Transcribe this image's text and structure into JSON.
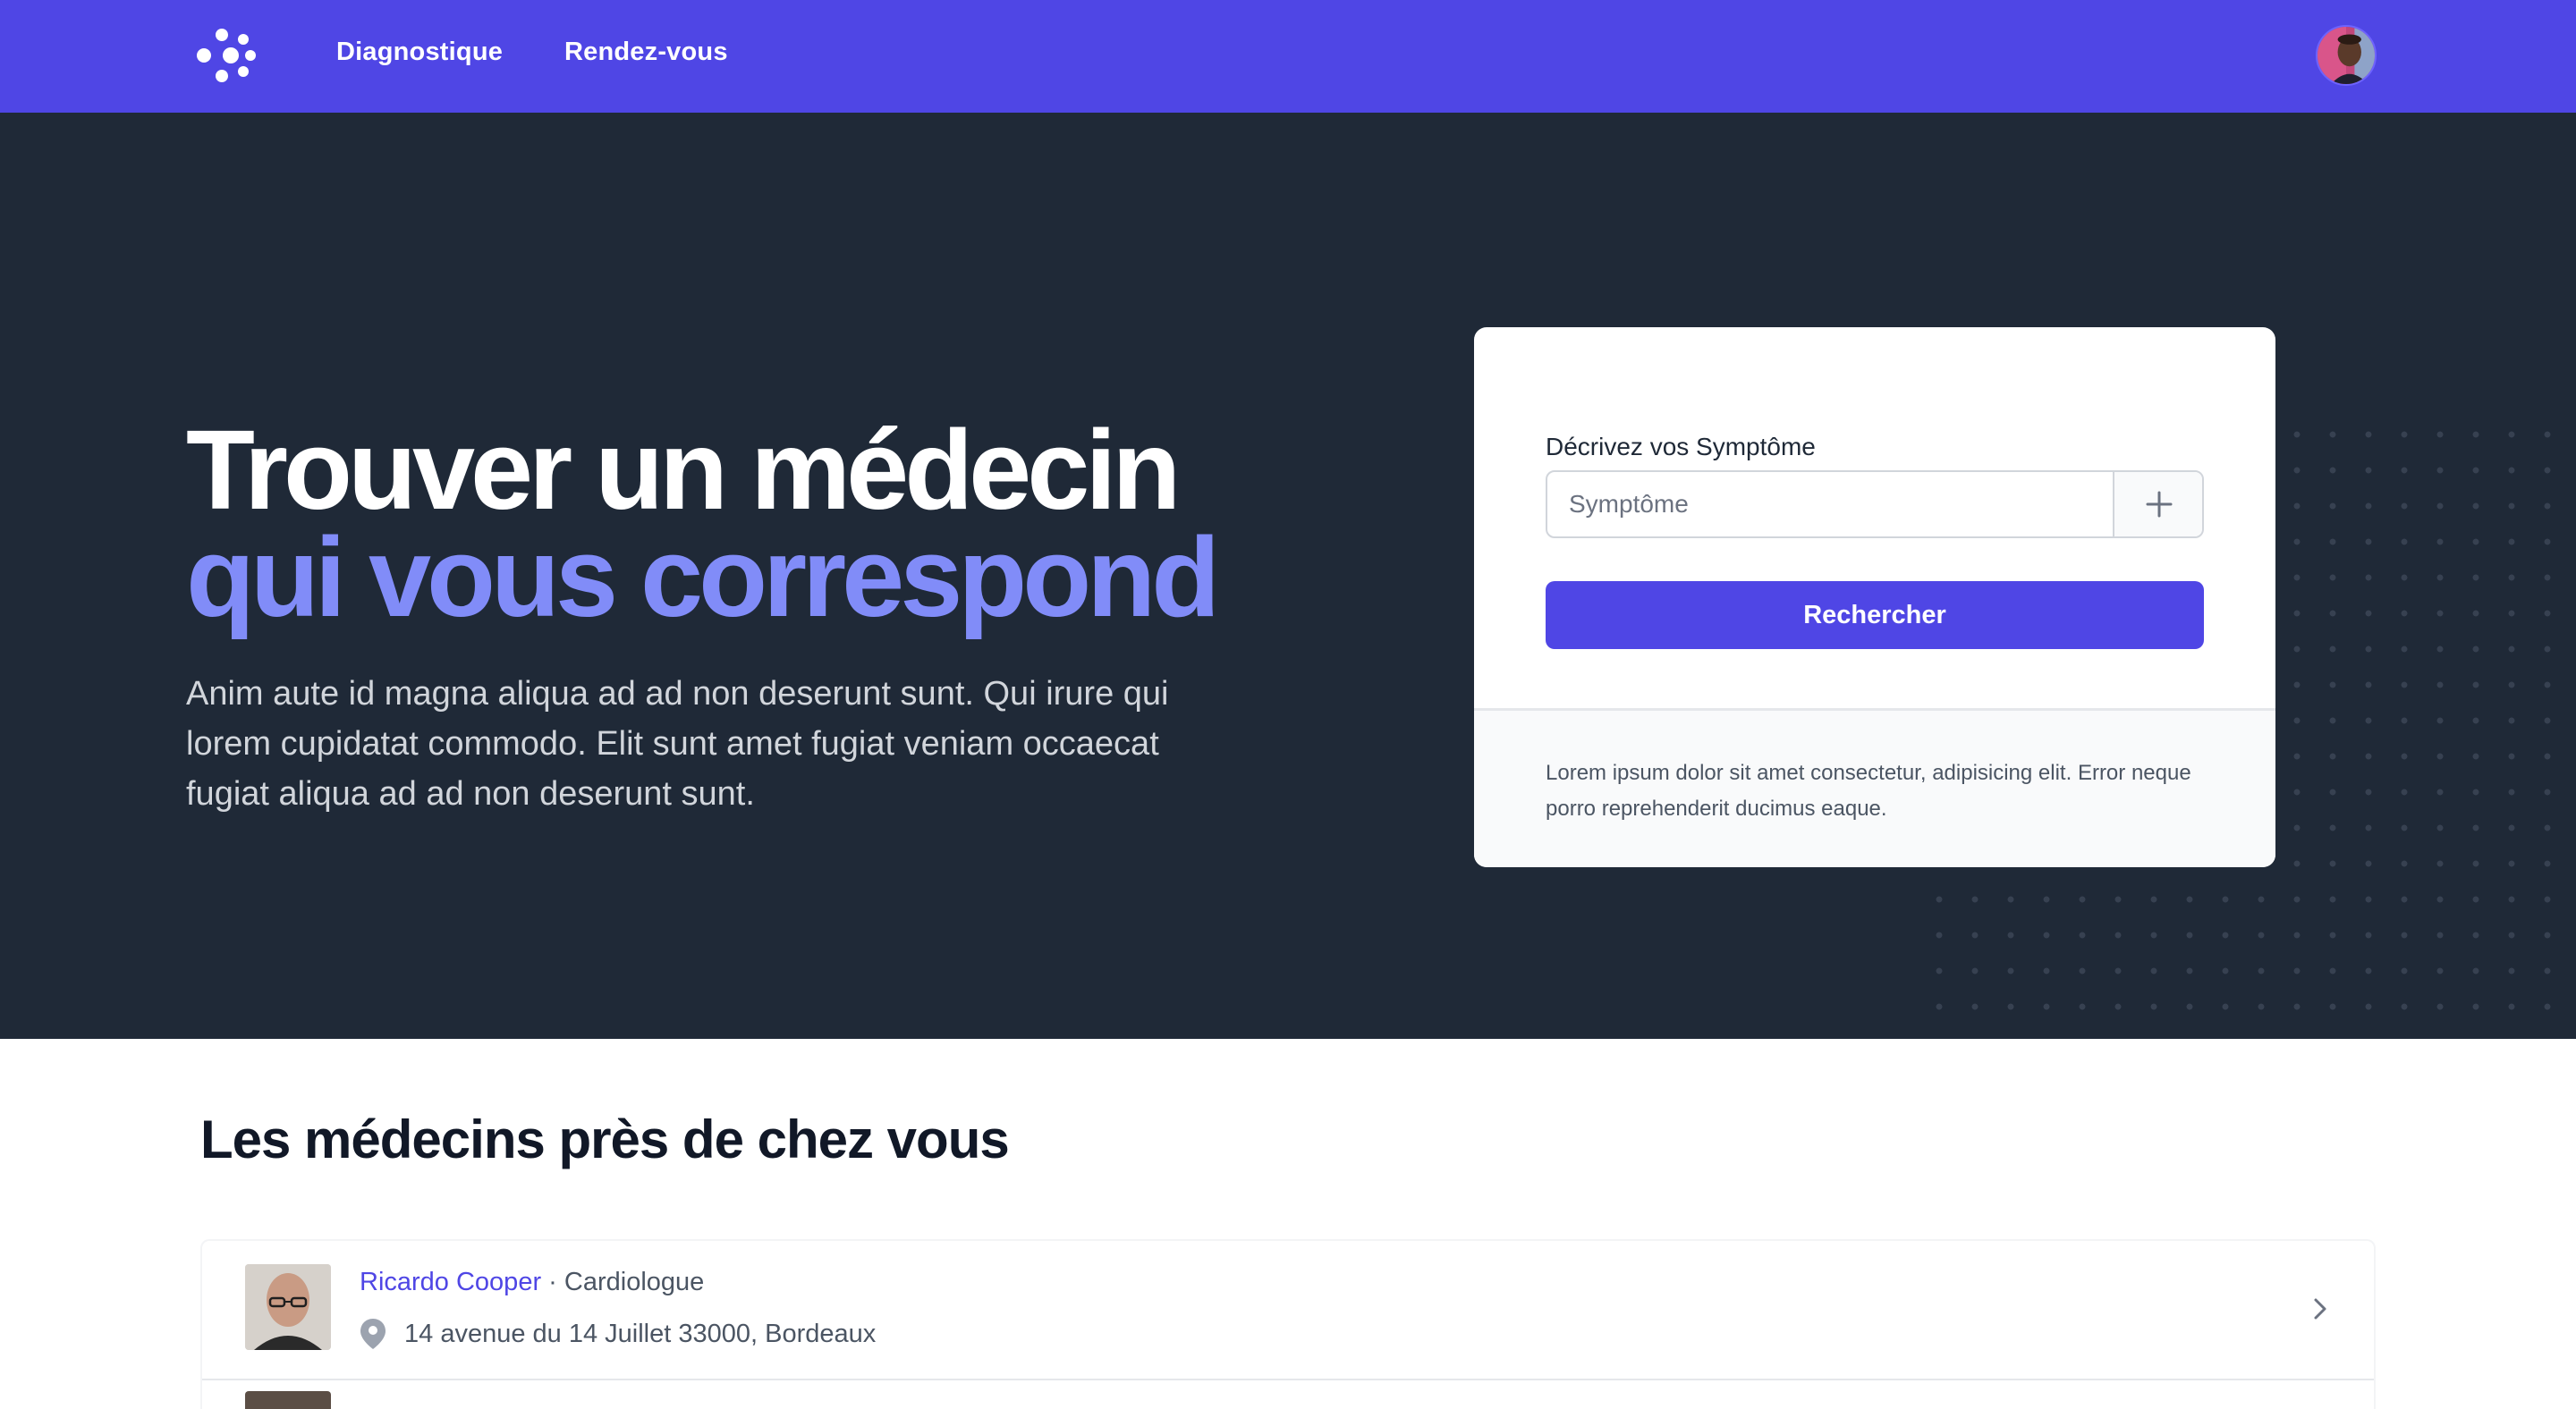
{
  "nav": {
    "links": [
      "Diagnostique",
      "Rendez-vous"
    ]
  },
  "hero": {
    "title_line1": "Trouver un médecin",
    "title_line2": "qui vous correspond",
    "description": "Anim aute id magna aliqua ad ad non deserunt sunt. Qui irure qui lorem cupidatat commodo. Elit sunt amet fugiat veniam occaecat fugiat aliqua ad ad non deserunt sunt."
  },
  "search_card": {
    "label": "Décrivez vos Symptôme",
    "input_value": "",
    "input_placeholder": "Symptôme",
    "submit_label": "Rechercher",
    "footer_text": "Lorem ipsum dolor sit amet consectetur, adipisicing elit. Error neque porro reprehenderit ducimus eaque."
  },
  "doctors_section": {
    "title": "Les médecins près de chez vous",
    "doctors": [
      {
        "name": "Ricardo Cooper",
        "separator": " · ",
        "specialty": "Cardiologue",
        "address": "14 avenue du 14 Juillet 33000, Bordeaux"
      }
    ]
  },
  "colors": {
    "brand": "#4f46e5",
    "hero_bg": "#1f2937",
    "accent_text": "#818cf8"
  },
  "icons": [
    "logo-icon",
    "avatar",
    "plus-icon",
    "location-pin-icon",
    "chevron-right-icon"
  ]
}
